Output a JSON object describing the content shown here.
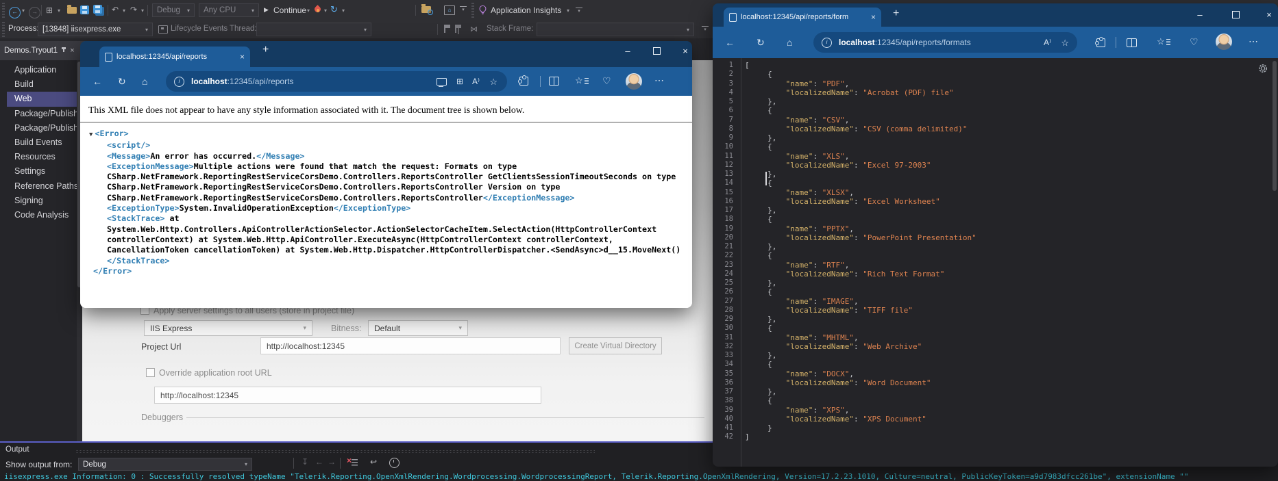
{
  "vs": {
    "toolbar": {
      "debug_config": "Debug",
      "platform": "Any CPU",
      "continue_label": "Continue",
      "app_insights_label": "Application Insights",
      "process_label": "Process:",
      "process_value": "[13848] iisexpress.exe",
      "lifecycle_label": "Lifecycle Events",
      "thread_label": "Thread:",
      "stack_frame_label": "Stack Frame:"
    },
    "doc_tab": {
      "title": "Demos.Tryout1"
    },
    "sidebar": {
      "selected": "Web",
      "items": [
        "Application",
        "Build",
        "Web",
        "Package/Publish Web",
        "Package/Publish SQL",
        "Build Events",
        "Resources",
        "Settings",
        "Reference Paths",
        "Signing",
        "Code Analysis"
      ]
    },
    "settings_page": {
      "apply_server_settings_label": "Apply server settings to all users (store in project file)",
      "server_value": "IIS Express",
      "bitness_label": "Bitness:",
      "bitness_value": "Default",
      "project_url_label": "Project Url",
      "project_url_value": "http://localhost:12345",
      "create_vd_label": "Create Virtual Directory",
      "override_label": "Override application root URL",
      "override_url_value": "http://localhost:12345",
      "debuggers_label": "Debuggers"
    },
    "output": {
      "panel_title": "Output",
      "show_from_label": "Show output from:",
      "source_value": "Debug",
      "log_line": "iisexpress.exe Information: 0 : Successfully resolved typeName \"Telerik.Reporting.OpenXmlRendering.Wordprocessing.WordprocessingReport, Telerik.Reporting.OpenXmlRendering, Version=17.2.23.1010, Culture=neutral, PublicKeyToken=a9d7983dfcc261be\", extensionName \"\""
    }
  },
  "browser_mid": {
    "tab_title": "localhost:12345/api/reports",
    "url_host": "localhost",
    "url_rest": ":12345/api/reports",
    "notice": "This XML file does not appear to have any style information associated with it. The document tree is shown below.",
    "xml_lines": [
      {
        "ind": 0,
        "segs": [
          [
            "arrow",
            "▼"
          ],
          [
            "tag",
            "<Error>"
          ]
        ]
      },
      {
        "ind": 1,
        "segs": [
          [
            "tag",
            "<script/>"
          ]
        ]
      },
      {
        "ind": 1,
        "segs": [
          [
            "tag",
            "<Message>"
          ],
          [
            "text",
            "An error has occurred."
          ],
          [
            "tag",
            "</Message>"
          ]
        ]
      },
      {
        "ind": 1,
        "segs": [
          [
            "tag",
            "<ExceptionMessage>"
          ],
          [
            "text",
            "Multiple actions were found that match the request: Formats on type"
          ]
        ]
      },
      {
        "ind": 1,
        "segs": [
          [
            "text",
            "CSharp.NetFramework.ReportingRestServiceCorsDemo.Controllers.ReportsController GetClientsSessionTimeoutSeconds on type"
          ]
        ]
      },
      {
        "ind": 1,
        "segs": [
          [
            "text",
            "CSharp.NetFramework.ReportingRestServiceCorsDemo.Controllers.ReportsController Version on type"
          ]
        ]
      },
      {
        "ind": 1,
        "segs": [
          [
            "text",
            "CSharp.NetFramework.ReportingRestServiceCorsDemo.Controllers.ReportsController"
          ],
          [
            "tag",
            "</ExceptionMessage>"
          ]
        ]
      },
      {
        "ind": 1,
        "segs": [
          [
            "tag",
            "<ExceptionType>"
          ],
          [
            "text",
            "System.InvalidOperationException"
          ],
          [
            "tag",
            "</ExceptionType>"
          ]
        ]
      },
      {
        "ind": 1,
        "segs": [
          [
            "tag",
            "<StackTrace>"
          ],
          [
            "text",
            " at"
          ]
        ]
      },
      {
        "ind": 1,
        "segs": [
          [
            "text",
            "System.Web.Http.Controllers.ApiControllerActionSelector.ActionSelectorCacheItem.SelectAction(HttpControllerContext"
          ]
        ]
      },
      {
        "ind": 1,
        "segs": [
          [
            "text",
            "controllerContext) at System.Web.Http.ApiController.ExecuteAsync(HttpControllerContext controllerContext,"
          ]
        ]
      },
      {
        "ind": 1,
        "segs": [
          [
            "text",
            "CancellationToken cancellationToken) at System.Web.Http.Dispatcher.HttpControllerDispatcher.<SendAsync>d__15.MoveNext()"
          ]
        ]
      },
      {
        "ind": 1,
        "segs": [
          [
            "tag",
            "</StackTrace>"
          ]
        ]
      },
      {
        "ind": 2,
        "segs": [
          [
            "tag",
            "</Error>"
          ]
        ]
      }
    ]
  },
  "browser_right": {
    "tab_title": "localhost:12345/api/reports/form",
    "url_host": "localhost",
    "url_rest": ":12345/api/reports/formats",
    "formats": [
      {
        "name": "PDF",
        "localizedName": "Acrobat (PDF) file"
      },
      {
        "name": "CSV",
        "localizedName": "CSV (comma delimited)"
      },
      {
        "name": "XLS",
        "localizedName": "Excel 97-2003"
      },
      {
        "name": "XLSX",
        "localizedName": "Excel Worksheet"
      },
      {
        "name": "PPTX",
        "localizedName": "PowerPoint Presentation"
      },
      {
        "name": "RTF",
        "localizedName": "Rich Text Format"
      },
      {
        "name": "IMAGE",
        "localizedName": "TIFF file"
      },
      {
        "name": "MHTML",
        "localizedName": "Web Archive"
      },
      {
        "name": "DOCX",
        "localizedName": "Word Document"
      },
      {
        "name": "XPS",
        "localizedName": "XPS Document"
      }
    ]
  },
  "icons": {
    "back": "←",
    "forward": "→",
    "caret": "▾",
    "refresh": "↻",
    "home": "⌂",
    "star": "☆",
    "close": "×",
    "plus": "+",
    "more": "⋯",
    "minimize": "–",
    "undo": "↶",
    "redo": "↷",
    "play": "▶",
    "restart": "↻",
    "apps": "⊞",
    "read_aloud": "A⁾",
    "info": "i",
    "heart": "♡",
    "new_item": "⊞",
    "wrap": "↩",
    "jump": "↧",
    "thread_link": "⋈"
  },
  "colors": {
    "vs_accent": "#5b5fc7",
    "edge_frame": "#143a61",
    "edge_chrome": "#1e5c99",
    "edge_pill": "#15497e",
    "selection": "#4b4b80",
    "output_info": "#3fc6da",
    "xml_tag": "#2e7db2",
    "json_key": "#d6b36a",
    "json_string": "#de8350"
  }
}
